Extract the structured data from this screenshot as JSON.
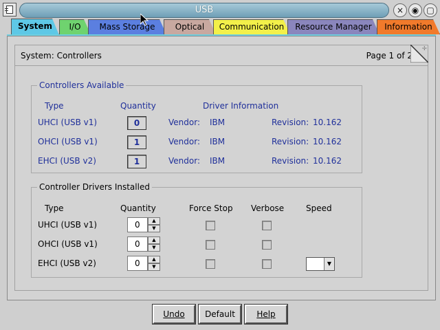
{
  "window": {
    "title": "USB",
    "controls": [
      "minimize-icon",
      "maximize-icon",
      "close-icon"
    ]
  },
  "tabs": [
    {
      "label": "System",
      "color": "#5ec8e6",
      "active": true
    },
    {
      "label": "I/O",
      "color": "#6fd36f"
    },
    {
      "label": "Mass Storage",
      "color": "#5b7fe0"
    },
    {
      "label": "Optical",
      "color": "#c8a8a0"
    },
    {
      "label": "Communication",
      "color": "#f3f04a"
    },
    {
      "label": "Resource Manager",
      "color": "#8a86bd"
    },
    {
      "label": "Information",
      "color": "#f17a2b"
    }
  ],
  "header": {
    "breadcrumb": "System: Controllers",
    "page": "Page 1 of 2"
  },
  "available": {
    "legend": "Controllers Available",
    "col_type": "Type",
    "col_qty": "Quantity",
    "col_driver": "Driver Information",
    "rows": [
      {
        "type": "UHCI (USB v1)",
        "qty": "0",
        "vendor_label": "Vendor:",
        "vendor": "IBM",
        "rev_label": "Revision:",
        "rev": "10.162"
      },
      {
        "type": "OHCI (USB v1)",
        "qty": "1",
        "vendor_label": "Vendor:",
        "vendor": "IBM",
        "rev_label": "Revision:",
        "rev": "10.162"
      },
      {
        "type": "EHCI (USB v2)",
        "qty": "1",
        "vendor_label": "Vendor:",
        "vendor": "IBM",
        "rev_label": "Revision:",
        "rev": "10.162"
      }
    ]
  },
  "installed": {
    "legend": "Controller Drivers Installed",
    "col_type": "Type",
    "col_qty": "Quantity",
    "col_force": "Force Stop",
    "col_verbose": "Verbose",
    "col_speed": "Speed",
    "rows": [
      {
        "type": "UHCI (USB v1)",
        "qty": "0"
      },
      {
        "type": "OHCI (USB v1)",
        "qty": "0"
      },
      {
        "type": "EHCI (USB v2)",
        "qty": "0"
      }
    ]
  },
  "buttons": {
    "undo": "Undo",
    "default": "Default",
    "help": "Help"
  }
}
